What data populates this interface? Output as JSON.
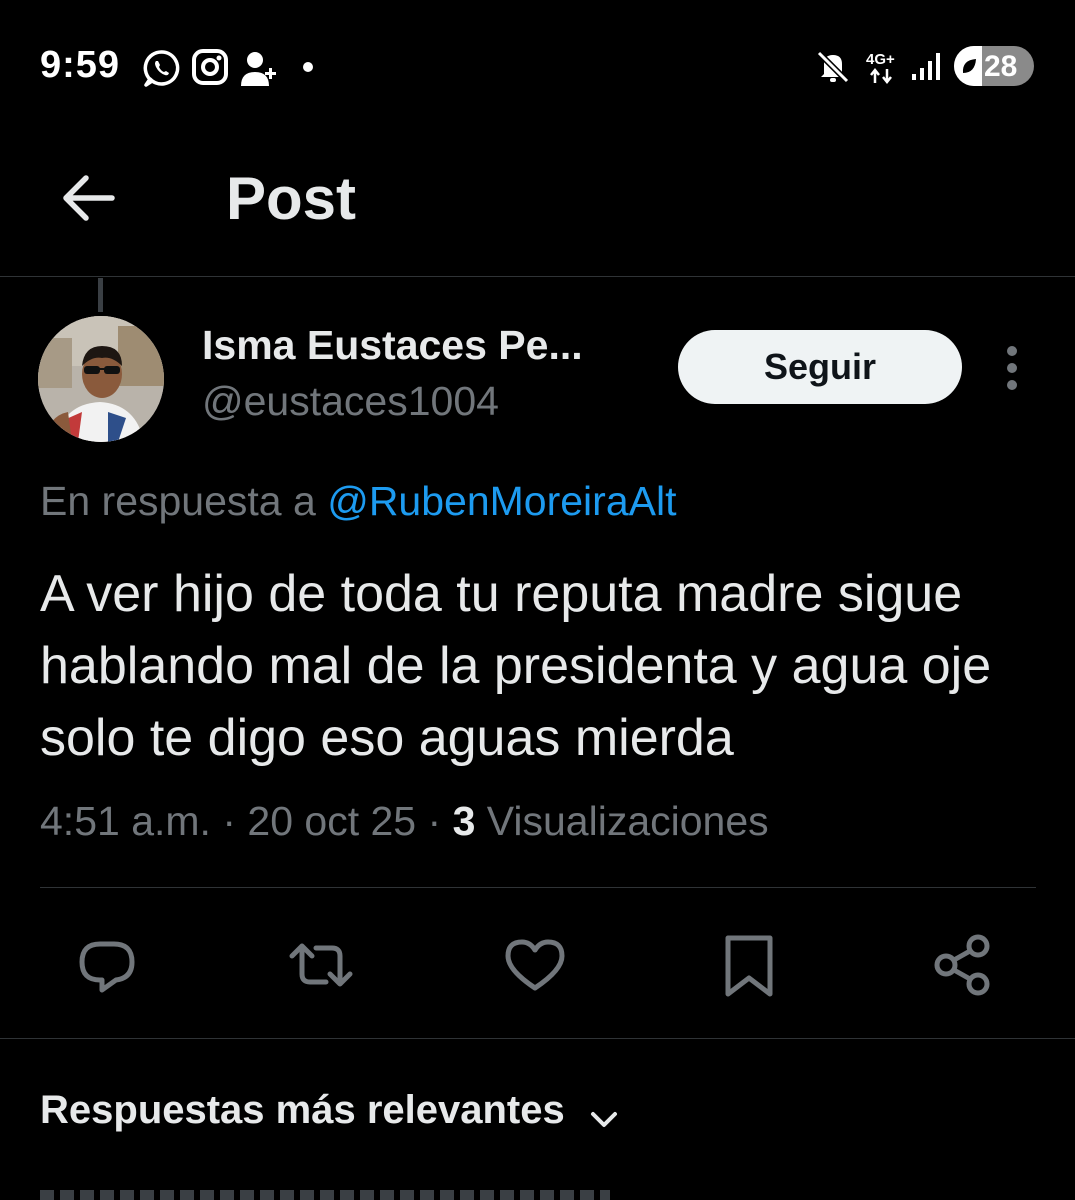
{
  "status_bar": {
    "time": "9:59",
    "network": "4G+",
    "battery_percent": "28",
    "icons": [
      "whatsapp-icon",
      "instagram-icon",
      "add-contact-icon",
      "notification-dot-icon",
      "mute-icon",
      "network-arrows-icon",
      "signal-icon",
      "battery-icon"
    ]
  },
  "header": {
    "title": "Post",
    "back_icon": "arrow-left-icon"
  },
  "post": {
    "author_name": "Isma Eustaces Pe...",
    "author_handle": "@eustaces1004",
    "follow_label": "Seguir",
    "reply_to_prefix": "En respuesta a",
    "reply_to_handle": "@RubenMoreiraAlt",
    "text": "A ver hijo de toda tu reputa madre sigue hablando mal de la presidenta y agua oje solo te digo eso aguas mierda",
    "time": "4:51 a.m.",
    "date": "20 oct 25",
    "separator": "·",
    "views_count": "3",
    "views_label": "Visualizaciones"
  },
  "actions": [
    {
      "icon": "reply-icon"
    },
    {
      "icon": "repost-icon"
    },
    {
      "icon": "like-icon"
    },
    {
      "icon": "bookmark-icon"
    },
    {
      "icon": "share-icon"
    }
  ],
  "replies": {
    "sort_label": "Respuestas más relevantes",
    "sort_icon": "chevron-down-icon"
  },
  "colors": {
    "background": "#000000",
    "text_primary": "#e7e9ea",
    "text_secondary": "#71767b",
    "link": "#1d9bf0",
    "divider": "#2f3336",
    "follow_button_bg": "#eff3f4"
  }
}
